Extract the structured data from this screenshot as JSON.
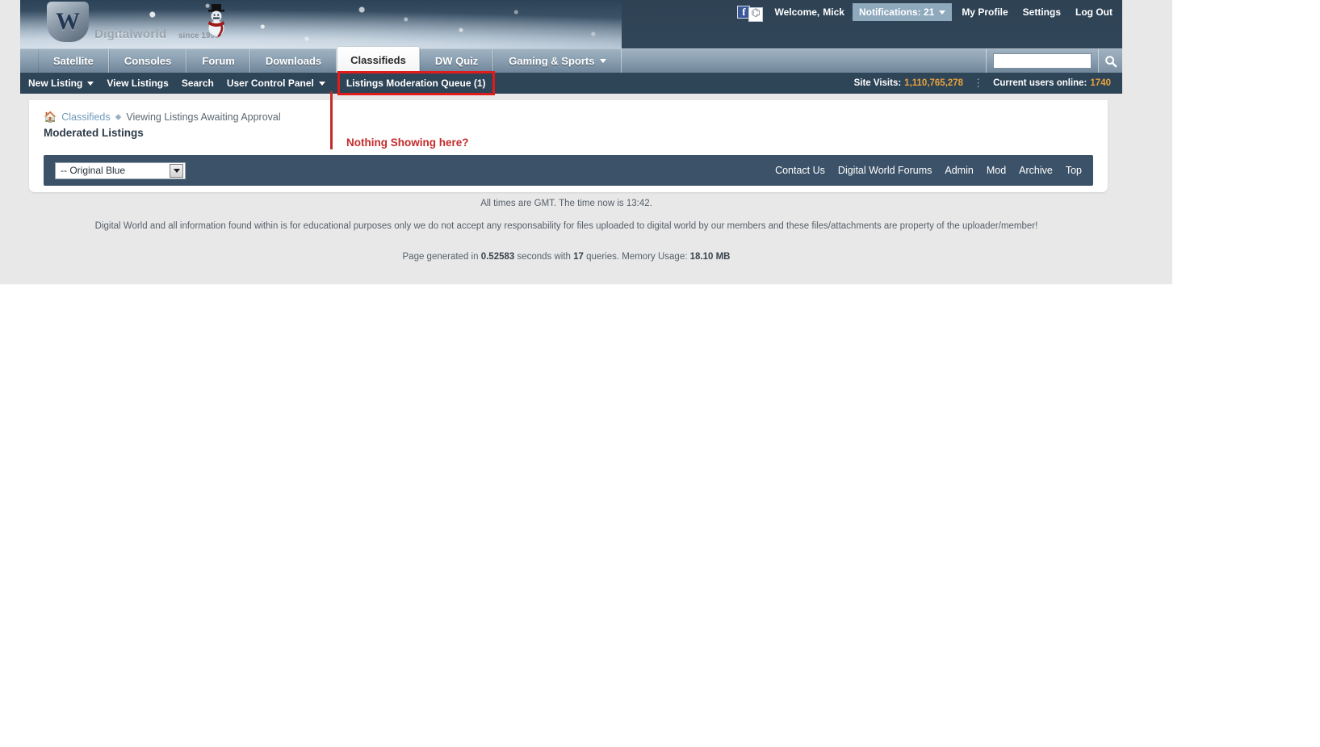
{
  "site": {
    "logo_text": "Digitalworld",
    "logo_since": "since 1999",
    "logo_shield_letter": "W"
  },
  "userbar": {
    "facebook_icon": "facebook-icon",
    "rss_icon": "rss-icon",
    "welcome_label": "Welcome,",
    "username": "Mick",
    "notifications": "Notifications: 21",
    "links": [
      {
        "label": "My Profile"
      },
      {
        "label": "Settings"
      },
      {
        "label": "Log Out"
      }
    ]
  },
  "mainnav": {
    "tabs": [
      {
        "label": "Satellite",
        "active": false,
        "caret": false
      },
      {
        "label": "Consoles",
        "active": false,
        "caret": false
      },
      {
        "label": "Forum",
        "active": false,
        "caret": false
      },
      {
        "label": "Downloads",
        "active": false,
        "caret": false
      },
      {
        "label": "Classifieds",
        "active": true,
        "caret": false
      },
      {
        "label": "DW Quiz",
        "active": false,
        "caret": false
      },
      {
        "label": "Gaming & Sports",
        "active": false,
        "caret": true
      }
    ],
    "search_value": "",
    "search_placeholder": "",
    "search_icon": "search-icon"
  },
  "subnav": {
    "items": [
      {
        "label": "New Listing",
        "caret": true,
        "boxed": false
      },
      {
        "label": "View Listings",
        "caret": false,
        "boxed": false
      },
      {
        "label": "Search",
        "caret": false,
        "boxed": false
      },
      {
        "label": "User Control Panel",
        "caret": true,
        "boxed": false
      },
      {
        "label": "Listings Moderation Queue (1)",
        "caret": false,
        "boxed": true
      }
    ],
    "site_visits_label": "Site Visits:",
    "site_visits_value": "1,110,765,278",
    "separator": "⋮",
    "users_online_label": "Current users online:",
    "users_online_value": "1740"
  },
  "annotation": {
    "text": "Nothing Showing here?",
    "color": "#c42b2b"
  },
  "content": {
    "breadcrumb": {
      "home_icon": "home-icon",
      "root": "Classifieds",
      "separator": "⬥",
      "current": "Viewing Listings Awaiting Approval"
    },
    "page_title": "Moderated Listings"
  },
  "footer_strip": {
    "style_selected": "-- Original Blue",
    "links": [
      {
        "label": "Contact Us"
      },
      {
        "label": "Digital World Forums"
      },
      {
        "label": "Admin"
      },
      {
        "label": "Mod"
      },
      {
        "label": "Archive"
      },
      {
        "label": "Top"
      }
    ]
  },
  "legal": {
    "time_line": "All times are GMT. The time now is 13:42.",
    "disclaimer": "Digital World and all information found within is for educational purposes only we do not accept any responsability for files uploaded to digital world by our members and these files/attachments are property of the uploader/member!",
    "gen_prefix": "Page generated in ",
    "gen_seconds": "0.52583",
    "gen_mid": " seconds with ",
    "gen_queries": "17",
    "gen_mid2": " queries. Memory Usage: ",
    "gen_memory": "18.10 MB"
  },
  "colors": {
    "dark_navy": "#2e4457",
    "panel_navy": "#3c5268",
    "accent_orange": "#e8a33d",
    "annotation_red": "#c42b2b",
    "page_grey": "#e8e8e8"
  }
}
